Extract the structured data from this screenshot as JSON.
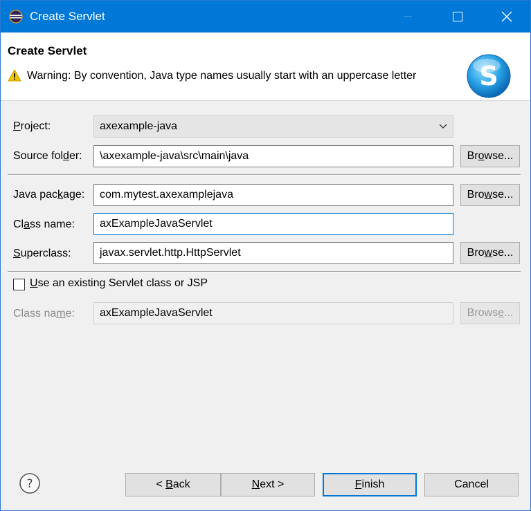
{
  "window": {
    "title": "Create Servlet",
    "accent": "#0078d7"
  },
  "header": {
    "heading": "Create Servlet",
    "warning": "Warning: By convention, Java type names usually start with an uppercase letter",
    "warning_icon": "warning-triangle",
    "logo_letter": "S"
  },
  "form": {
    "project": {
      "label_pre": "",
      "label_u": "P",
      "label_post": "roject:",
      "value": "axexample-java"
    },
    "source_folder": {
      "label_pre": "Source fol",
      "label_u": "d",
      "label_post": "er:",
      "value": "\\axexample-java\\src\\main\\java"
    },
    "java_package": {
      "label_pre": "Java pac",
      "label_u": "k",
      "label_post": "age:",
      "value": "com.mytest.axexamplejava"
    },
    "class_name": {
      "label_pre": "Cl",
      "label_u": "a",
      "label_post": "ss name:",
      "value": "axExampleJavaServlet"
    },
    "superclass": {
      "label_pre": "",
      "label_u": "S",
      "label_post": "uperclass:",
      "value": "javax.servlet.http.HttpServlet"
    },
    "use_existing": {
      "label_pre": "",
      "label_u": "U",
      "label_post": "se an existing Servlet class or JSP",
      "checked": false
    },
    "existing_class_name": {
      "label_pre": "Class na",
      "label_u": "m",
      "label_post": "e:",
      "value": "axExampleJavaServlet"
    }
  },
  "browse": {
    "pre": "Br",
    "u": "o",
    "post": "wse..."
  },
  "browse_w": {
    "pre": "Bro",
    "u": "w",
    "post": "se..."
  },
  "browse_e": {
    "pre": "Brows",
    "u": "e",
    "post": "..."
  },
  "footer": {
    "back": {
      "pre": "< ",
      "u": "B",
      "post": "ack"
    },
    "next": {
      "pre": "",
      "u": "N",
      "post": "ext >"
    },
    "finish": {
      "pre": "",
      "u": "F",
      "post": "inish"
    },
    "cancel": "Cancel"
  }
}
